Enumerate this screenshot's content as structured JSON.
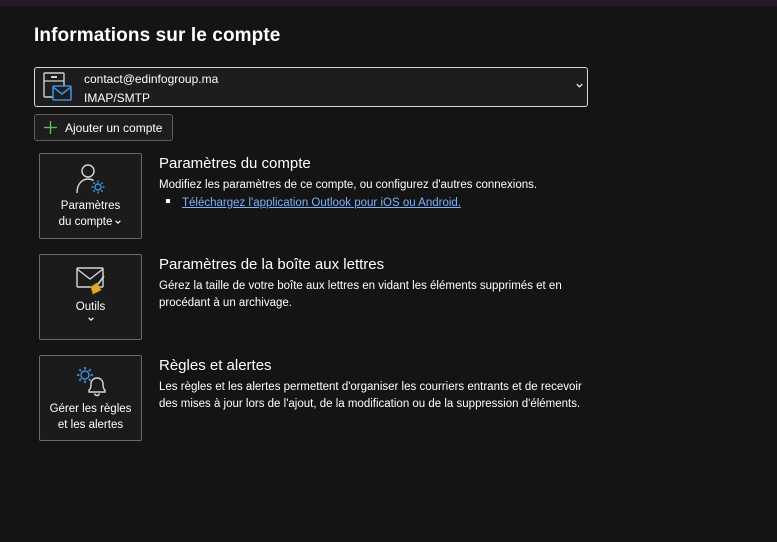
{
  "page": {
    "title": "Informations sur le compte"
  },
  "account": {
    "email": "contact@edinfogroup.ma",
    "type": "IMAP/SMTP"
  },
  "add_account": {
    "label": "Ajouter un compte"
  },
  "sections": [
    {
      "tile_label_line1": "Paramètres",
      "tile_label_line2": "du compte",
      "title": "Paramètres du compte",
      "description": "Modifiez les paramètres de ce compte, ou configurez d'autres connexions.",
      "link": "Téléchargez l'application Outlook pour iOS ou Android."
    },
    {
      "tile_label_line1": "Outils",
      "title": "Paramètres de la boîte aux lettres",
      "description": "Gérez la taille de votre boîte aux lettres en vidant les éléments supprimés et en procédant à un archivage."
    },
    {
      "tile_label_line1": "Gérer les règles",
      "tile_label_line2": "et les alertes",
      "title": "Règles et alertes",
      "description": "Les règles et les alertes permettent d'organiser les courriers entrants et de recevoir des mises à jour lors de l'ajout, de la modification ou de la suppression d'éléments."
    }
  ],
  "colors": {
    "background": "#141414",
    "accent_blue": "#3b8fd6",
    "link": "#7cb2ff",
    "plus_green": "#5cb85c"
  },
  "icons": {
    "account": "mail-server-icon",
    "add": "plus-icon",
    "account_settings": "user-gear-icon",
    "tools": "mail-broom-icon",
    "rules": "gear-bell-icon"
  }
}
